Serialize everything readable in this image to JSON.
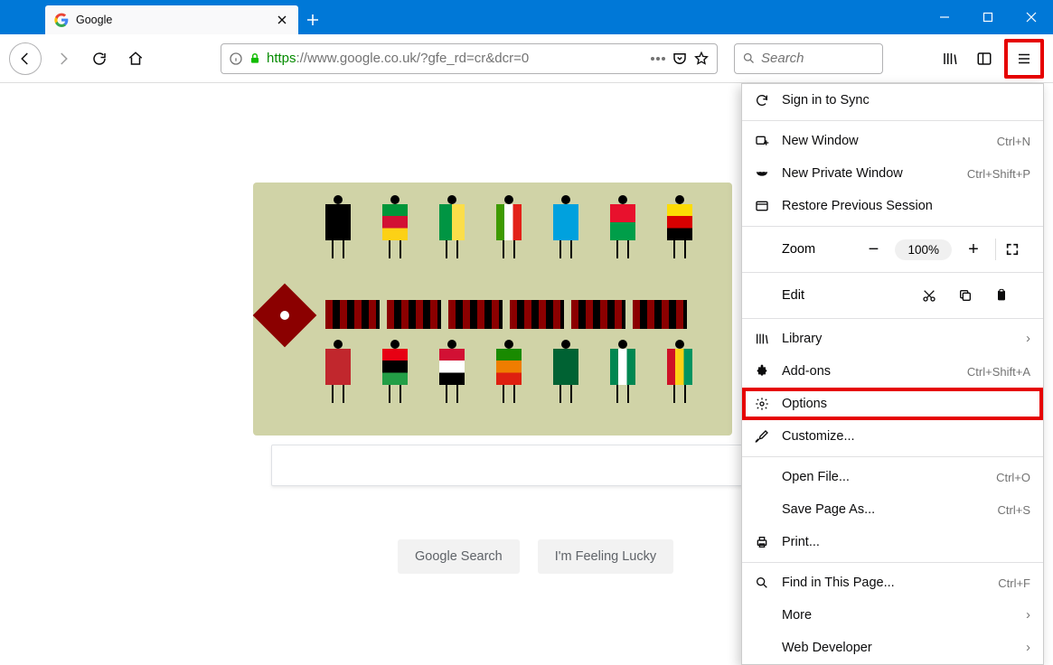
{
  "tab": {
    "title": "Google"
  },
  "url": {
    "protocol": "https",
    "rest": "://www.google.co.uk/?gfe_rd=cr&dcr=0"
  },
  "search": {
    "placeholder": "Search"
  },
  "buttons": {
    "google_search": "Google Search",
    "feeling_lucky": "I'm Feeling Lucky"
  },
  "menu": {
    "sign_in": "Sign in to Sync",
    "new_window": {
      "label": "New Window",
      "shortcut": "Ctrl+N"
    },
    "new_private": {
      "label": "New Private Window",
      "shortcut": "Ctrl+Shift+P"
    },
    "restore": "Restore Previous Session",
    "zoom": {
      "label": "Zoom",
      "value": "100%"
    },
    "edit": "Edit",
    "library": "Library",
    "addons": {
      "label": "Add-ons",
      "shortcut": "Ctrl+Shift+A"
    },
    "options": "Options",
    "customize": "Customize...",
    "open_file": {
      "label": "Open File...",
      "shortcut": "Ctrl+O"
    },
    "save_page": {
      "label": "Save Page As...",
      "shortcut": "Ctrl+S"
    },
    "print": "Print...",
    "find": {
      "label": "Find in This Page...",
      "shortcut": "Ctrl+F"
    },
    "more": "More",
    "web_dev": "Web Developer"
  }
}
